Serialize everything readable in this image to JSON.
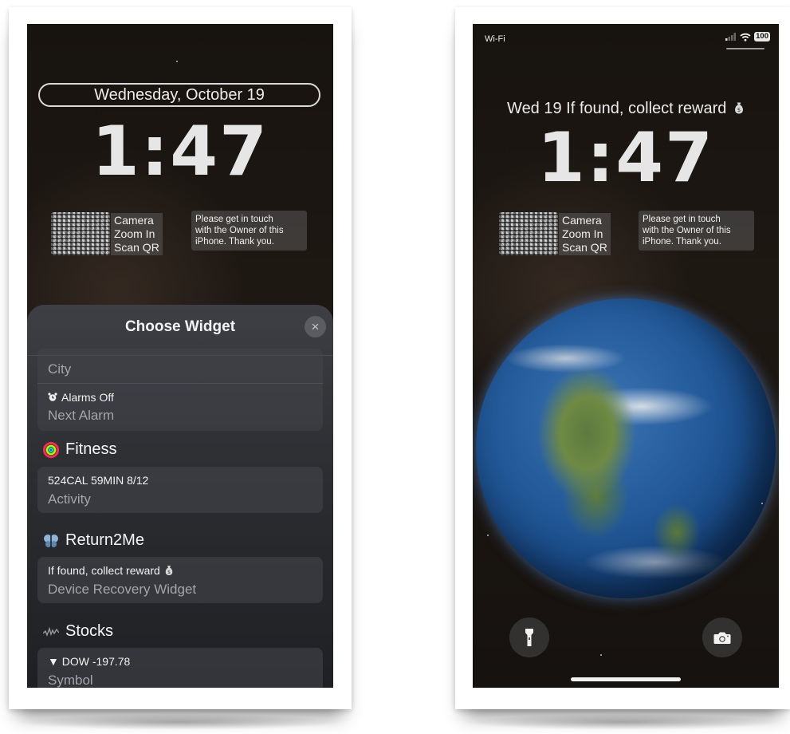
{
  "left_screen": {
    "date": "Wednesday, October 19",
    "time": "1:47",
    "qr_widget": {
      "line1": "Camera",
      "line2": "Zoom In",
      "line3": "Scan QR"
    },
    "owner_message": [
      "Please get in touch",
      "with the Owner of this",
      "iPhone. Thank you."
    ],
    "sheet": {
      "title": "Choose Widget",
      "close_icon": "×",
      "clock_card": {
        "top_item": "City",
        "alarm_line": "Alarms Off",
        "alarm_label": "Next Alarm"
      },
      "fitness": {
        "title": "Fitness",
        "value": "524CAL 59MIN 8/12",
        "label": "Activity"
      },
      "return2me": {
        "title": "Return2Me",
        "value": "If found, collect reward",
        "label": "Device Recovery Widget"
      },
      "stocks": {
        "title": "Stocks",
        "value": "▼ DOW -197.78",
        "label": "Symbol"
      }
    }
  },
  "right_screen": {
    "status": {
      "carrier": "Wi-Fi",
      "battery": "100"
    },
    "info_line": "Wed 19  If found, collect reward",
    "time": "1:47",
    "qr_widget": {
      "line1": "Camera",
      "line2": "Zoom In",
      "line3": "Scan QR"
    },
    "owner_message": [
      "Please get in touch",
      "with the Owner of this",
      "iPhone. Thank you."
    ]
  },
  "icons": {
    "close": "close-icon",
    "alarm": "alarm-clock-icon",
    "fitness": "activity-rings-icon",
    "return2me": "butterfly-icon",
    "stocks": "stock-chart-icon",
    "money_bag": "money-bag-icon",
    "flashlight": "flashlight-icon",
    "camera": "camera-icon",
    "signal": "signal-bars-icon",
    "wifi": "wifi-icon",
    "battery": "battery-icon"
  },
  "colors": {
    "sheet_bg": "#2c2d31",
    "card_bg": "#46474d",
    "secondary_text": "#a4a5aa",
    "earth_ocean": "#215796"
  }
}
